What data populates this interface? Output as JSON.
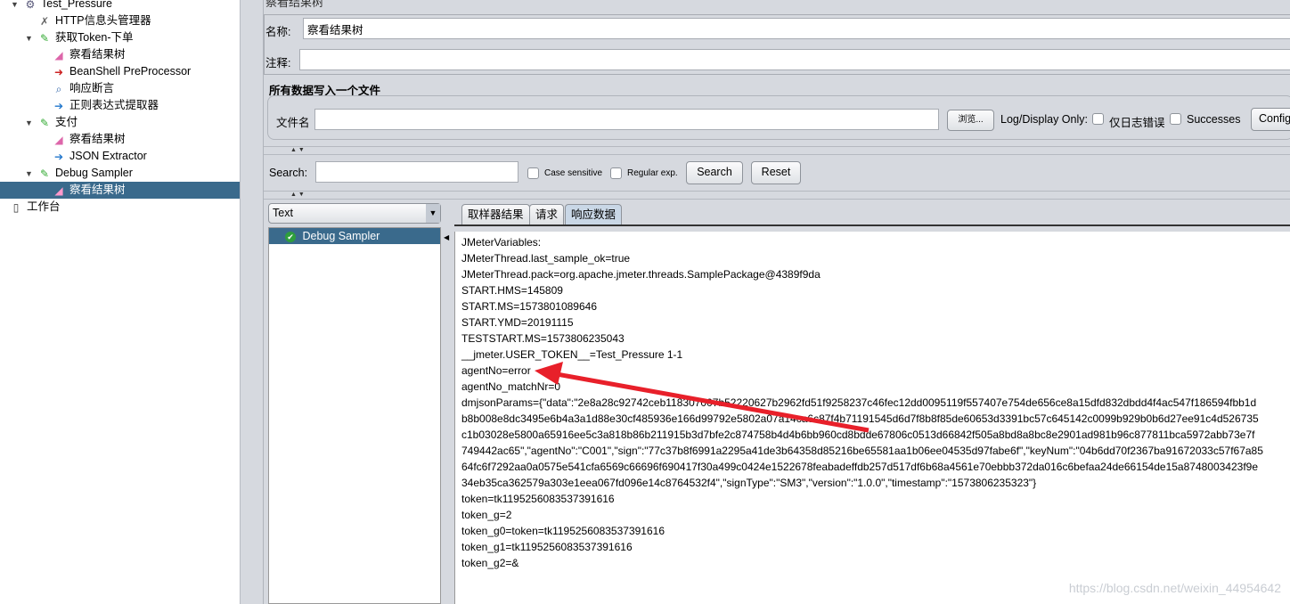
{
  "tree": [
    {
      "label": "Test_Pressure",
      "icon": "gear-icon",
      "level": 0,
      "expanded": true
    },
    {
      "label": "HTTP信息头管理器",
      "icon": "wrench-icon",
      "level": 1
    },
    {
      "label": "获取Token-下单",
      "icon": "pipette-icon",
      "level": 1,
      "expanded": true
    },
    {
      "label": "察看结果树",
      "icon": "graph-icon",
      "level": 2
    },
    {
      "label": "BeanShell PreProcessor",
      "icon": "preprocessor-icon",
      "level": 2
    },
    {
      "label": "响应断言",
      "icon": "magnifier-icon",
      "level": 2
    },
    {
      "label": "正则表达式提取器",
      "icon": "extractor-icon",
      "level": 2
    },
    {
      "label": "支付",
      "icon": "pipette-icon",
      "level": 1,
      "expanded": true
    },
    {
      "label": "察看结果树",
      "icon": "graph-icon",
      "level": 2
    },
    {
      "label": "JSON Extractor",
      "icon": "extractor-icon",
      "level": 2
    },
    {
      "label": "Debug Sampler",
      "icon": "pipette-icon",
      "level": 1,
      "expanded": true
    },
    {
      "label": "察看结果树",
      "icon": "graph-icon",
      "level": 2,
      "selected": true
    },
    {
      "label": "工作台",
      "icon": "notebook-icon",
      "level": 0
    }
  ],
  "panel": {
    "title": "察看结果树",
    "name_label": "名称:",
    "name_value": "察看结果树",
    "comment_label": "注释:",
    "comment_value": "",
    "file_section": "所有数据写入一个文件",
    "file_label": "文件名",
    "file_value": "",
    "browse": "浏览...",
    "log_display": "Log/Display Only:",
    "errors_only": "仅日志错误",
    "successes": "Successes",
    "configure": "Config"
  },
  "search": {
    "label": "Search:",
    "value": "",
    "case_sensitive": "Case sensitive",
    "regex": "Regular exp.",
    "search_btn": "Search",
    "reset_btn": "Reset"
  },
  "renderer": {
    "selected": "Text"
  },
  "results": [
    {
      "label": "Debug Sampler",
      "status": "success"
    }
  ],
  "tabs": [
    {
      "label": "取样器结果"
    },
    {
      "label": "请求"
    },
    {
      "label": "响应数据",
      "active": true
    }
  ],
  "response_lines": [
    "JMeterVariables:",
    "JMeterThread.last_sample_ok=true",
    "JMeterThread.pack=org.apache.jmeter.threads.SamplePackage@4389f9da",
    "START.HMS=145809",
    "START.MS=1573801089646",
    "START.YMD=20191115",
    "TESTSTART.MS=1573806235043",
    "__jmeter.USER_TOKEN__=Test_Pressure 1-1",
    "agentNo=error",
    "agentNo_matchNr=0",
    "dmjsonParams={\"data\":\"2e8a28c92742ceb118307007b52220627b2962fd51f9258237c46fec12dd0095119f557407e754de656ce8a15dfd832dbdd4f4ac547f186594fbb1d",
    "b8b008e8dc3495e6b4a3a1d88e30cf485936e166d99792e5802a07a14ca6c87f4b71191545d6d7f8b8f85de60653d3391bc57c645142c0099b929b0b6d27ee91c4d526735",
    "c1b03028e5800a65916ee5c3a818b86b211915b3d7bfe2c874758b4d4b6bb960cd8bdde67806c0513d66842f505a8bd8a8bc8e2901ad981b96c877811bca5972abb73e7f",
    "749442ac65\",\"agentNo\":\"C001\",\"sign\":\"77c37b8f6991a2295a41de3b64358d85216be65581aa1b06ee04535d97fabe6f\",\"keyNum\":\"04b6dd70f2367ba91672033c57f67a85",
    "64fc6f7292aa0a0575e541cfa6569c66696f690417f30a499c0424e1522678feabadeffdb257d517df6b68a4561e70ebbb372da016c6befaa24de66154de15a8748003423f9e",
    "34eb35ca362579a303e1eea067fd096e14c8764532f4\",\"signType\":\"SM3\",\"version\":\"1.0.0\",\"timestamp\":\"1573806235323\"}",
    "token=tk1195256083537391616",
    "token_g=2",
    "token_g0=token=tk1195256083537391616",
    "token_g1=tk1195256083537391616",
    "token_g2=&"
  ],
  "watermark": "https://blog.csdn.net/weixin_44954642",
  "colors": {
    "selection": "#3a6a8c",
    "annotation_arrow": "#e8202a"
  }
}
